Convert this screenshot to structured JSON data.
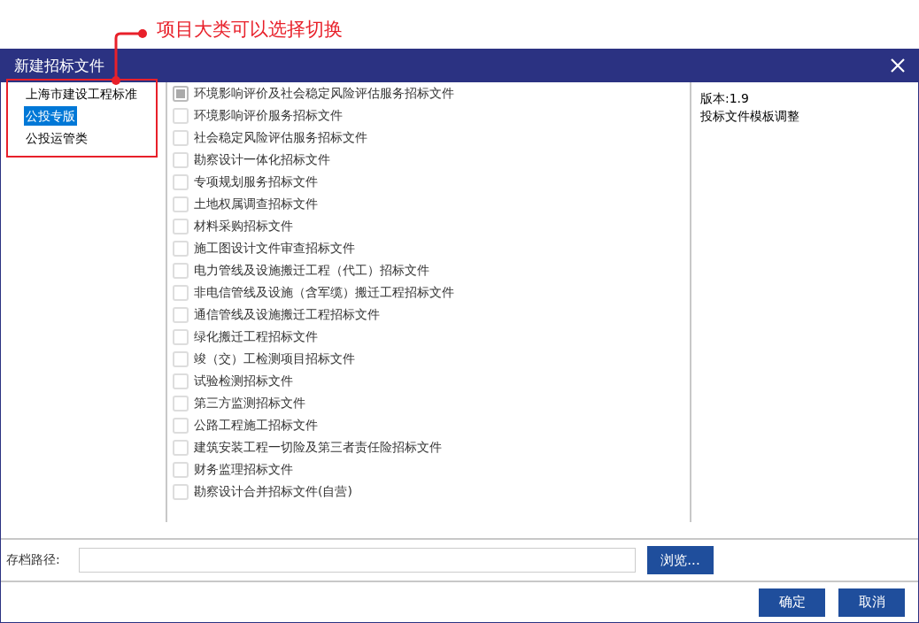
{
  "annotation": {
    "text": "项目大类可以选择切换"
  },
  "window": {
    "title": "新建招标文件"
  },
  "categories": [
    {
      "label": "上海市建设工程标准",
      "selected": false
    },
    {
      "label": "公投专版",
      "selected": true
    },
    {
      "label": "公投运管类",
      "selected": false
    }
  ],
  "templates": [
    {
      "label": "环境影响评价及社会稳定风险评估服务招标文件",
      "checked": true
    },
    {
      "label": "环境影响评价服务招标文件",
      "checked": false
    },
    {
      "label": "社会稳定风险评估服务招标文件",
      "checked": false
    },
    {
      "label": "勘察设计一体化招标文件",
      "checked": false
    },
    {
      "label": "专项规划服务招标文件",
      "checked": false
    },
    {
      "label": "土地权属调查招标文件",
      "checked": false
    },
    {
      "label": "材料采购招标文件",
      "checked": false
    },
    {
      "label": "施工图设计文件审查招标文件",
      "checked": false
    },
    {
      "label": "电力管线及设施搬迁工程（代工）招标文件",
      "checked": false
    },
    {
      "label": "非电信管线及设施（含军缆）搬迁工程招标文件",
      "checked": false
    },
    {
      "label": "通信管线及设施搬迁工程招标文件",
      "checked": false
    },
    {
      "label": "绿化搬迁工程招标文件",
      "checked": false
    },
    {
      "label": "竣（交）工检测项目招标文件",
      "checked": false
    },
    {
      "label": "试验检测招标文件",
      "checked": false
    },
    {
      "label": "第三方监测招标文件",
      "checked": false
    },
    {
      "label": "公路工程施工招标文件",
      "checked": false
    },
    {
      "label": "建筑安装工程一切险及第三者责任险招标文件",
      "checked": false
    },
    {
      "label": "财务监理招标文件",
      "checked": false
    },
    {
      "label": "勘察设计合并招标文件(自营)",
      "checked": false
    }
  ],
  "info": [
    "版本:1.9",
    "投标文件模板调整"
  ],
  "path": {
    "label": "存档路径:",
    "browse_button": "浏览..."
  },
  "buttons": [
    "确定",
    "取消"
  ]
}
